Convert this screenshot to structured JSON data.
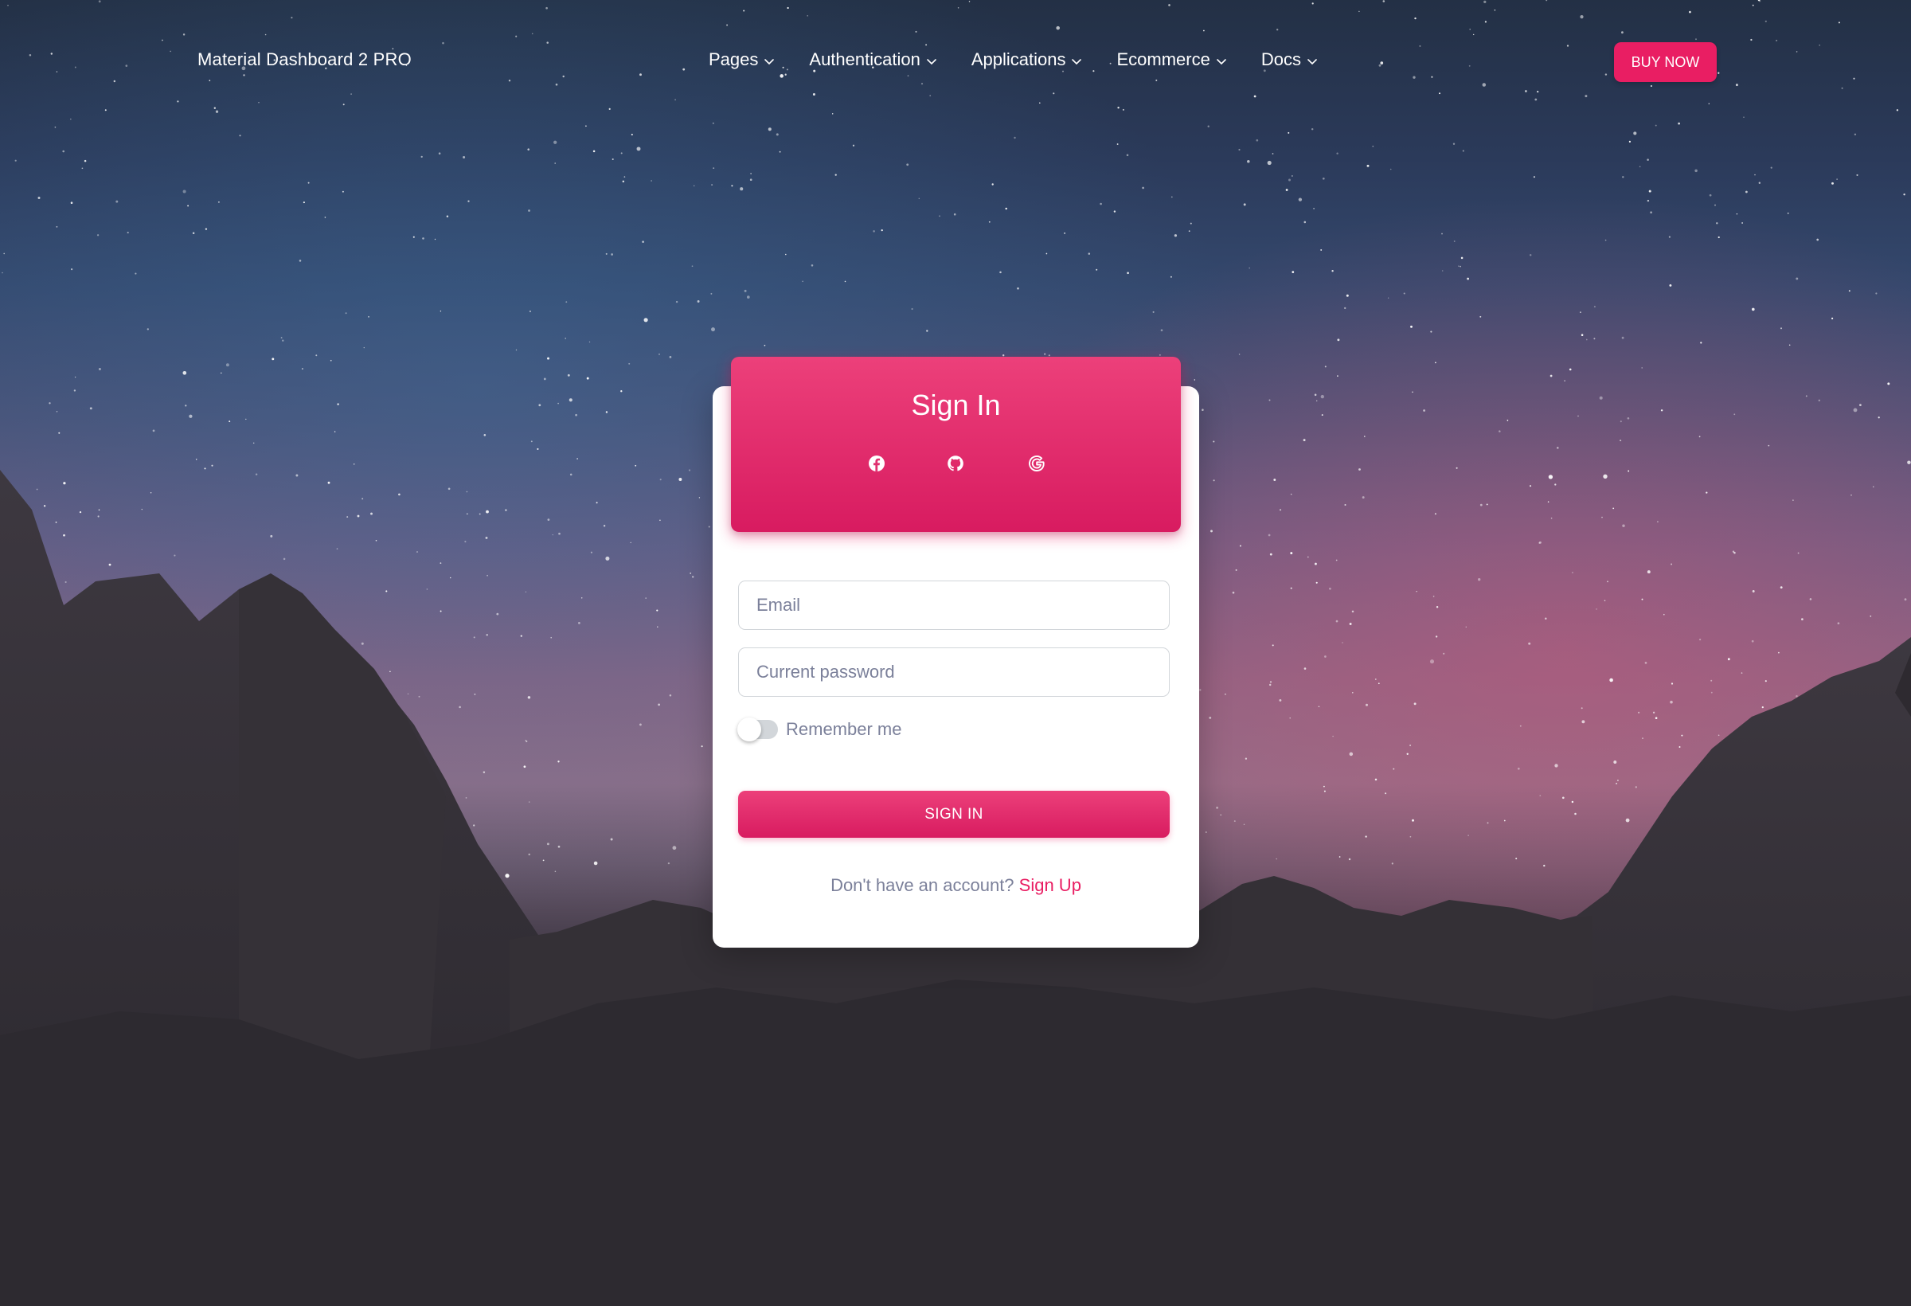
{
  "navbar": {
    "brand": "Material Dashboard 2 PRO",
    "links": [
      {
        "label": "Pages",
        "icon": "chevron-down-icon"
      },
      {
        "label": "Authentication",
        "icon": "chevron-down-icon"
      },
      {
        "label": "Applications",
        "icon": "chevron-down-icon"
      },
      {
        "label": "Ecommerce",
        "icon": "chevron-down-icon"
      },
      {
        "label": "Docs",
        "icon": "chevron-down-icon"
      }
    ],
    "buy_button": "BUY NOW"
  },
  "card": {
    "title": "Sign In",
    "social_icons": [
      "facebook-icon",
      "github-icon",
      "google-icon"
    ],
    "email_placeholder": "Email",
    "email_value": "",
    "password_placeholder": "Current password",
    "password_value": "",
    "remember_label": "Remember me",
    "remember_checked": false,
    "signin_button": "SIGN IN",
    "no_account_text": "Don't have an account?",
    "signup_link": "Sign Up"
  },
  "colors": {
    "accent": "#e91e63",
    "muted_text": "#7b809a",
    "input_border": "#d2d6da"
  }
}
